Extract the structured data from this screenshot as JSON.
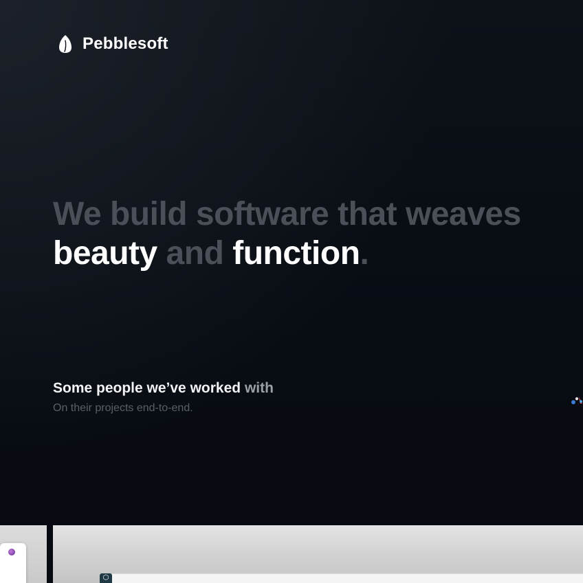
{
  "brand": {
    "name": "Pebblesoft",
    "logo_icon": "pebble-icon"
  },
  "hero": {
    "line1": "We build software that weaves",
    "line2_part1": "beauty",
    "line2_part2": " and ",
    "line2_part3": "function",
    "line2_period": "."
  },
  "clients": {
    "title_strong": "Some people we’ve worked ",
    "title_fade": "with",
    "subtitle": "On their projects end-to-end.",
    "logo_icon": "client-logo-icon"
  },
  "preview": {
    "app_icon": "hexagon-app-icon",
    "app_icon_glyph": "⬡"
  },
  "colors": {
    "background": "#070b12",
    "text_primary": "#ffffff",
    "text_dim": "#4b5058",
    "text_muted": "#5a5f68"
  }
}
